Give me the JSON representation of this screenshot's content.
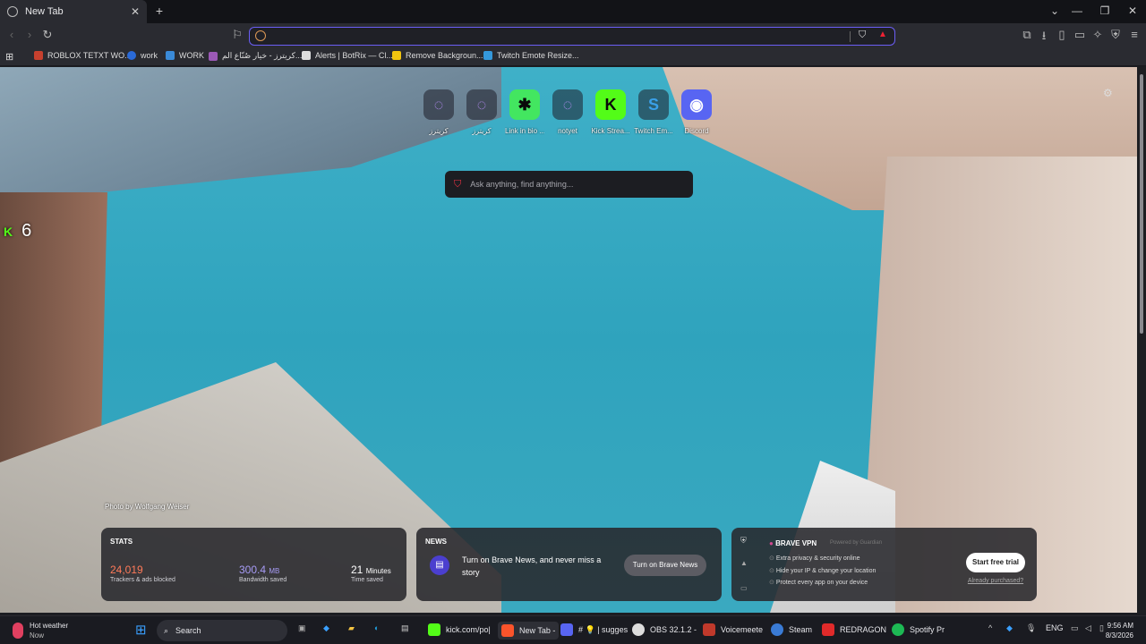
{
  "browser": {
    "tab_title": "New Tab",
    "new_tab": "+",
    "win_controls": [
      "⌄",
      "—",
      "❐",
      "✕"
    ]
  },
  "bookmarks": [
    {
      "label": "ROBLOX TETXT WO...",
      "color": "#c6402e"
    },
    {
      "label": "work",
      "color": "#2a6ad8"
    },
    {
      "label": "WORK",
      "color": "#3a8ad8"
    },
    {
      "label": "كريترز - خيار صُنّاع الم...",
      "color": "#9b59b6"
    },
    {
      "label": "Alerts | BotRix — Cl...",
      "color": "#dddddd"
    },
    {
      "label": "Remove Backgroun...",
      "color": "#f1c40f"
    },
    {
      "label": "Twitch Emote Resize...",
      "color": "#3498db"
    }
  ],
  "top_sites": [
    {
      "label": "كريترز",
      "glyph": "◌",
      "color": "#b48cf5"
    },
    {
      "label": "كريترز",
      "glyph": "◌",
      "color": "#b48cf5"
    },
    {
      "label": "Link in bio ...",
      "glyph": "✱",
      "color": "#43e660"
    },
    {
      "label": "notyet",
      "glyph": "◌",
      "color": "#b48cf5"
    },
    {
      "label": "Kick Strea...",
      "glyph": "K",
      "color": "#53fc18"
    },
    {
      "label": "Twitch Em...",
      "glyph": "S",
      "color": "#3aa0e8"
    },
    {
      "label": "Discord",
      "glyph": "◉",
      "color": "#5865f2"
    }
  ],
  "search": {
    "placeholder": "Ask anything, find anything..."
  },
  "kick_widget": {
    "count": "6"
  },
  "photo_credit": "Photo by Wolfgang Weiser",
  "stats": {
    "title": "STATS",
    "trackers_value": "24,019",
    "trackers_label": "Trackers & ads blocked",
    "bandwidth_value": "300.4",
    "bandwidth_unit": "MB",
    "bandwidth_label": "Bandwidth saved",
    "time_value": "21",
    "time_unit": "Minutes",
    "time_label": "Time saved"
  },
  "news": {
    "title": "NEWS",
    "text": "Turn on Brave News, and never miss a story",
    "button": "Turn on Brave News"
  },
  "vpn": {
    "title": "BRAVE VPN",
    "powered": "Powered by Guardian",
    "features": [
      "Extra privacy & security online",
      "Hide your IP & change your location",
      "Protect every app on your device"
    ],
    "button": "Start free trial",
    "link": "Already purchased?"
  },
  "taskbar": {
    "weather_title": "Hot weather",
    "weather_sub": "Now",
    "search": "Search",
    "apps": [
      {
        "label": "kick.com/po|",
        "color": "#53fc18"
      },
      {
        "label": "New Tab -",
        "color": "#fb542b"
      },
      {
        "label": "# 💡 | sugges",
        "color": "#5865f2"
      },
      {
        "label": "OBS 32.1.2 -",
        "color": "#dddddd"
      },
      {
        "label": "Voicemeete",
        "color": "#c0392b"
      },
      {
        "label": "Steam",
        "color": "#3a7bd5"
      },
      {
        "label": "REDRAGON",
        "color": "#e02a2a"
      },
      {
        "label": "Spotify Pr",
        "color": "#1db954"
      }
    ],
    "lang": "ENG",
    "time": "9:56 AM",
    "date": "8/3/2026"
  }
}
